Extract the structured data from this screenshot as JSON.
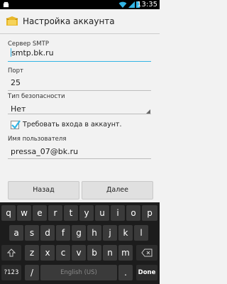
{
  "status_bar": {
    "time": "13:35"
  },
  "action_bar": {
    "title": "Настройка аккаунта"
  },
  "form": {
    "smtp_label": "Сервер SMTP",
    "smtp_value": "smtp.bk.ru",
    "port_label": "Порт",
    "port_value": "25",
    "security_label": "Тип безопасности",
    "security_value": "Нет",
    "require_login_label": "Требовать входа в аккаунт.",
    "require_login_checked": true,
    "username_label": "Имя пользователя",
    "username_value": "pressa_07@bk.ru"
  },
  "buttons": {
    "back": "Назад",
    "next": "Далее"
  },
  "keyboard": {
    "row1": [
      "q",
      "w",
      "e",
      "r",
      "t",
      "y",
      "u",
      "i",
      "o",
      "p"
    ],
    "row2": [
      "a",
      "s",
      "d",
      "f",
      "g",
      "h",
      "j",
      "k",
      "l"
    ],
    "row3": [
      "z",
      "x",
      "c",
      "v",
      "b",
      "n",
      "m"
    ],
    "symbols_key": "?123",
    "space_label": "English (US)",
    "done_key": "Done"
  },
  "colors": {
    "accent": "#33b5e5",
    "keyboard_bg": "#1c1c1c",
    "key_bg": "#3a3a3a"
  }
}
